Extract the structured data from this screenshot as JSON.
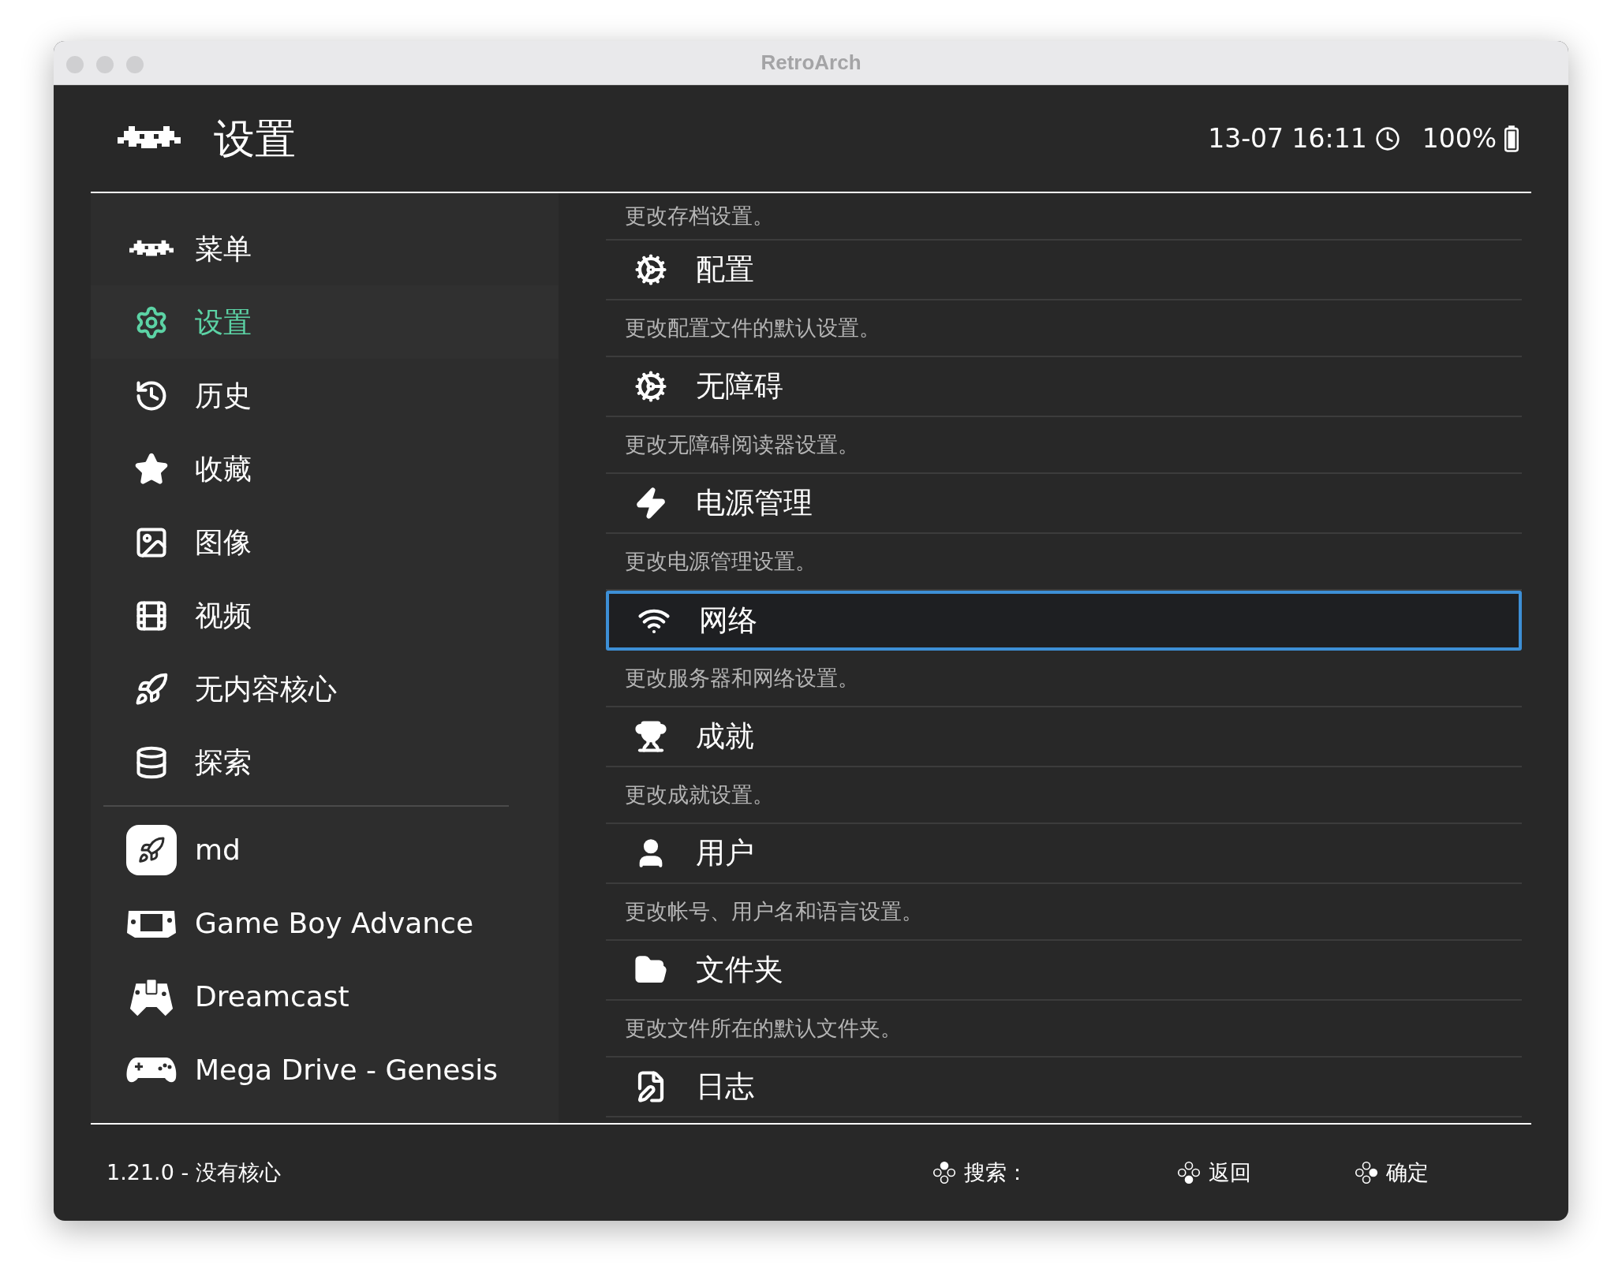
{
  "window": {
    "title": "RetroArch"
  },
  "header": {
    "title": "设置",
    "datetime": "13-07 16:11",
    "battery": "100%"
  },
  "sidebar": {
    "items": [
      {
        "label": "菜单",
        "selected": false
      },
      {
        "label": "设置",
        "selected": true
      },
      {
        "label": "历史",
        "selected": false
      },
      {
        "label": "收藏",
        "selected": false
      },
      {
        "label": "图像",
        "selected": false
      },
      {
        "label": "视频",
        "selected": false
      },
      {
        "label": "无内容核心",
        "selected": false
      },
      {
        "label": "探索",
        "selected": false
      }
    ],
    "playlists": [
      {
        "label": "md",
        "selected": false
      },
      {
        "label": "Game Boy Advance",
        "selected": false
      },
      {
        "label": "Dreamcast",
        "selected": false
      },
      {
        "label": "Mega Drive - Genesis",
        "selected": false
      }
    ]
  },
  "content": {
    "lead_description": "更改存档设置。",
    "items": [
      {
        "title": "配置",
        "description": "更改配置文件的默认设置。",
        "selected": false
      },
      {
        "title": "无障碍",
        "description": "更改无障碍阅读器设置。",
        "selected": false
      },
      {
        "title": "电源管理",
        "description": "更改电源管理设置。",
        "selected": false
      },
      {
        "title": "网络",
        "description": "更改服务器和网络设置。",
        "selected": true
      },
      {
        "title": "成就",
        "description": "更改成就设置。",
        "selected": false
      },
      {
        "title": "用户",
        "description": "更改帐号、用户名和语言设置。",
        "selected": false
      },
      {
        "title": "文件夹",
        "description": "更改文件所在的默认文件夹。",
        "selected": false
      },
      {
        "title": "日志",
        "selected": false
      }
    ]
  },
  "footer": {
    "version": "1.21.0 - 没有核心",
    "hints": [
      {
        "label": "搜索：",
        "kind": "top"
      },
      {
        "label": "返回",
        "kind": "bottom"
      },
      {
        "label": "确定",
        "kind": "right"
      }
    ]
  }
}
